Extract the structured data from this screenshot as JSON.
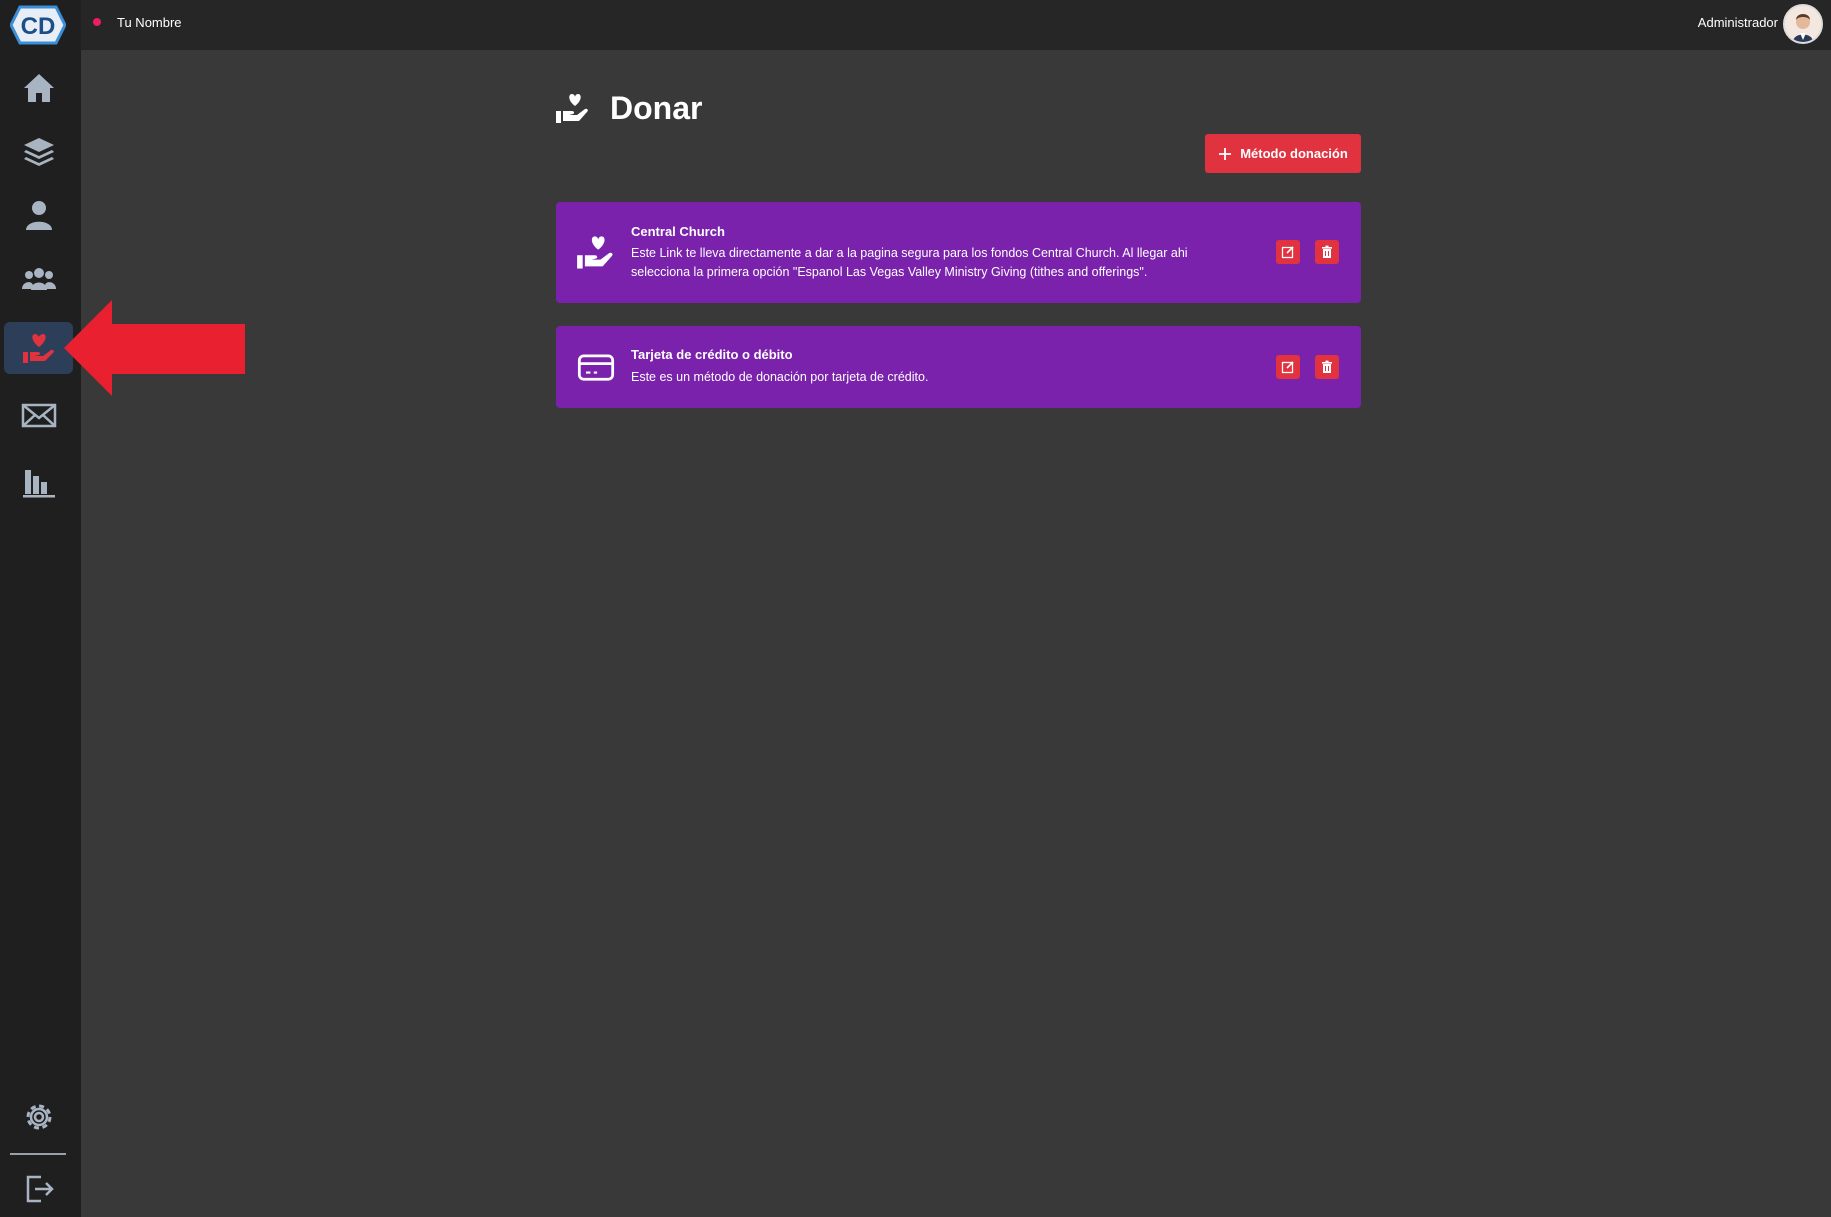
{
  "topbar": {
    "username": "Tu Nombre",
    "role": "Administrador"
  },
  "logo": {
    "text": "CD"
  },
  "sidebar": {
    "items": [
      {
        "icon": "home-icon"
      },
      {
        "icon": "layers-icon"
      },
      {
        "icon": "user-icon"
      },
      {
        "icon": "group-icon"
      },
      {
        "icon": "donate-icon",
        "active": true
      },
      {
        "icon": "mail-icon"
      },
      {
        "icon": "bar-chart-icon"
      }
    ],
    "bottom": [
      {
        "icon": "gear-icon"
      },
      {
        "icon": "logout-icon"
      }
    ]
  },
  "page": {
    "title": "Donar",
    "add_button": "Método donación"
  },
  "methods": [
    {
      "title": "Central Church",
      "description": "Este Link te lleva directamente a dar a la pagina segura para los fondos Central Church. Al llegar ahi selecciona la primera opción \"Espanol Las Vegas Valley Ministry Giving (tithes and offerings\".",
      "icon": "donate-hand-icon"
    },
    {
      "title": "Tarjeta de crédito o débito",
      "description": "Este es un método de donación por tarjeta de crédito.",
      "icon": "credit-card-icon"
    }
  ],
  "colors": {
    "accent": "#e0323f",
    "card": "#7b22ad",
    "background": "#393939",
    "sidebar": "#1f1f1f"
  }
}
